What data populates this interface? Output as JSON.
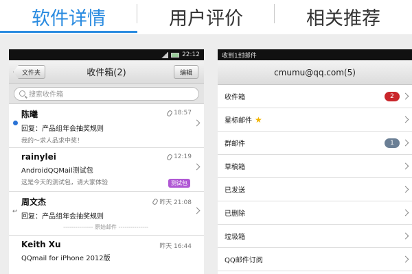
{
  "tabs": [
    {
      "label": "软件详情",
      "active": true
    },
    {
      "label": "用户评价",
      "active": false
    },
    {
      "label": "相关推荐",
      "active": false
    }
  ],
  "colors": {
    "accent": "#2a8be0",
    "unread_badge": "#c9262b",
    "group_badge": "#6b7f95",
    "tag": "#b058d4"
  },
  "left_phone": {
    "status_time": "22:12",
    "back_label": "文件夹",
    "title": "收件箱(2)",
    "edit_label": "编辑",
    "search_placeholder": "搜索收件箱",
    "mails": [
      {
        "sender": "陈曦",
        "time": "18:57",
        "subject": "回复：产品组年会抽奖规则",
        "preview": "我的～求人品求中奖！",
        "unread": true,
        "attachment": true
      },
      {
        "sender": "rainylei",
        "time": "12:19",
        "subject": "AndroidQQMail测试包",
        "preview": "这是今天的测试包，请大家体验",
        "tag": "测试包",
        "attachment": true
      },
      {
        "sender": "周文杰",
        "time": "昨天 21:08",
        "subject": "回复：产品组年会抽奖规则",
        "divider": "原始邮件",
        "replied": true,
        "attachment": true
      },
      {
        "sender": "Keith Xu",
        "time": "昨天 16:44",
        "subject": "QQmail for iPhone 2012版"
      }
    ]
  },
  "right_phone": {
    "status_text": "收到1封邮件",
    "account": "cmumu@qq.com(5)",
    "folders": [
      {
        "label": "收件箱",
        "badge": "2",
        "badge_color": "red"
      },
      {
        "label": "星标邮件",
        "star": true
      },
      {
        "label": "群邮件",
        "badge": "1",
        "badge_color": "grey"
      },
      {
        "label": "草稿箱"
      },
      {
        "label": "已发送"
      },
      {
        "label": "已删除"
      },
      {
        "label": "垃圾箱"
      },
      {
        "label": "QQ邮件订阅"
      }
    ]
  }
}
